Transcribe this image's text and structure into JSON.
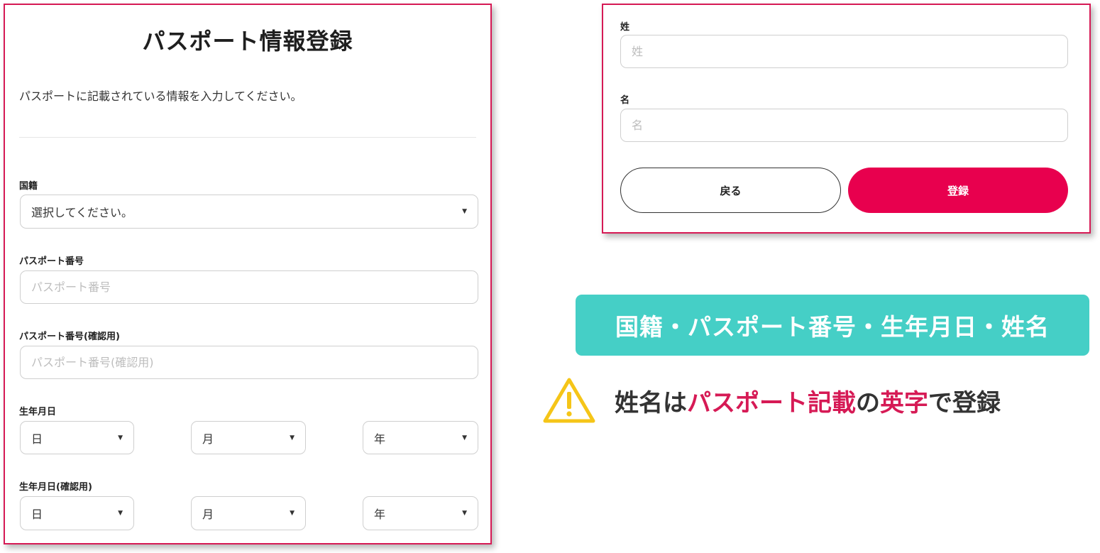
{
  "form": {
    "title": "パスポート情報登録",
    "description": "パスポートに記載されている情報を入力してください。",
    "nationality": {
      "label": "国籍",
      "value": "選択してください。"
    },
    "passport_number": {
      "label": "パスポート番号",
      "placeholder": "パスポート番号"
    },
    "passport_number_confirm": {
      "label": "パスポート番号(確認用)",
      "placeholder": "パスポート番号(確認用)"
    },
    "birthdate": {
      "label": "生年月日",
      "day": "日",
      "month": "月",
      "year": "年"
    },
    "birthdate_confirm": {
      "label": "生年月日(確認用)",
      "day": "日",
      "month": "月",
      "year": "年"
    },
    "last_name": {
      "label": "姓",
      "placeholder": "姓"
    },
    "first_name": {
      "label": "名",
      "placeholder": "名"
    },
    "back_label": "戻る",
    "register_label": "登録"
  },
  "banner": {
    "text": "国籍・パスポート番号・生年月日・姓名"
  },
  "warning": {
    "part1": "姓名は",
    "part2": "パスポート記載",
    "part3": "の",
    "part4": "英字",
    "part5": "で登録"
  },
  "icons": {
    "dropdown": "chevron-down-icon",
    "warning": "warning-triangle-icon"
  },
  "colors": {
    "accent": "#d61a55",
    "primary_button": "#e8004e",
    "banner": "#45cfc6",
    "warning_icon": "#f5c518"
  }
}
